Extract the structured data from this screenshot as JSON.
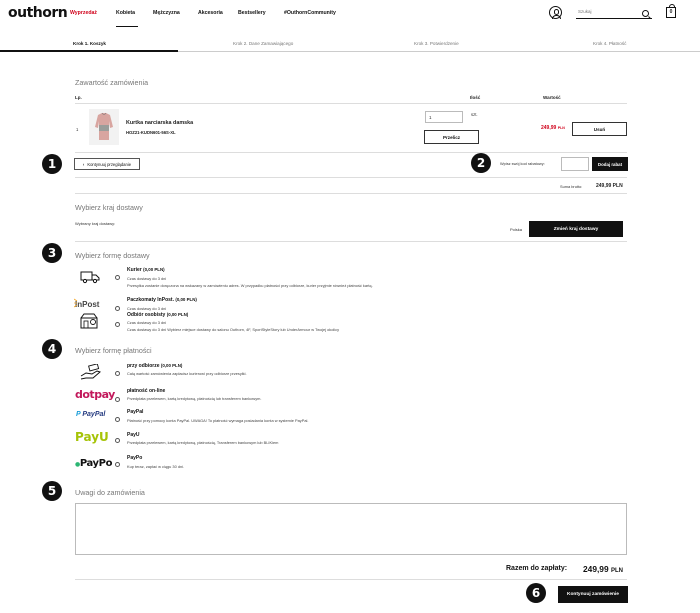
{
  "header": {
    "logo": "outhorn",
    "nav": [
      "Wyprzedaż",
      "Kobieta",
      "Mężczyzna",
      "Akcesoria",
      "Bestsellery",
      "#OuthornCommunity"
    ],
    "search_placeholder": "Szukaj",
    "cart_count": "0"
  },
  "steps": [
    "Krok 1. Koszyk",
    "Krok 2. Dane Zamawiającego",
    "Krok 3. Potwierdzenie",
    "Krok 4. Płatność"
  ],
  "cart": {
    "title": "Zawartość zamówienia",
    "col_lp": "Lp.",
    "col_qty": "Ilość",
    "col_value": "Wartość",
    "item": {
      "lp": "1",
      "name": "Kurtka narciarska damska",
      "sku": "HOZ21-KUDN601-56S-XL",
      "qty": "1",
      "unit": "szt.",
      "recalc": "Przelicz",
      "price": "249,99",
      "price_currency": "PLN",
      "remove": "Usuń"
    },
    "continue": "Kontynuuj przeglądanie",
    "coupon_label": "Wpisz swój kod rabatowy:",
    "coupon_value": "",
    "coupon_button": "Dodaj rabat",
    "gross_label": "Suma brutto:",
    "gross_value": "249,99 PLN"
  },
  "country": {
    "title": "Wybierz kraj dostawy",
    "selected_label": "Wybrany kraj dostawy:",
    "selected_value": "Polska",
    "change_button": "Zmień kraj dostawy"
  },
  "delivery": {
    "title": "Wybierz formę dostawy",
    "options": [
      {
        "name": "Kurier",
        "price": "(0,00 PLN)",
        "desc1": "Czas dostawy do 3 dni",
        "desc2": "Przesyłka zostanie doręczona na wskazany w zamówieniu adres. W przypadku płatności przy odbiorze, kurier przyjmie również płatność kartą."
      },
      {
        "name": "Paczkomaty InPost.",
        "price": "(0,00 PLN)",
        "desc1": "Czas dostawy do 3 dni",
        "desc2": ""
      },
      {
        "name": "Odbiór osobisty",
        "price": "(0,00 PLN)",
        "desc1": "Czas dostawy do 3 dni",
        "desc2": "Czas dostawy do 3 dni Wybierz miejsce dostawy do salonu Outhorn, 4F, SportStyleStory lub UnderArmour w Twojej okolicy"
      }
    ],
    "icons": [
      "truck-icon",
      "inpost-logo",
      "store-pickup-icon"
    ]
  },
  "payment": {
    "title": "Wybierz formę płatności",
    "options": [
      {
        "name": "przy odbiorze",
        "price": "(0,00 PLN)",
        "desc": "Całą wartość zamówienia zapłacisz kurierowi przy odbiorze przesyłki.",
        "logo": "hand-cash-icon"
      },
      {
        "name": "płatność on-line",
        "price": "",
        "desc": "Przedpłata przelewem, kartą kredytową, płatnością lub transferem bankowym.",
        "logo": "dotpay"
      },
      {
        "name": "PayPal",
        "price": "",
        "desc": "Płatność przy pomocy konta PayPal. UWAGA! To płatność wymaga posiadania konta w systemie PayPal.",
        "logo": "PayPal"
      },
      {
        "name": "PayU",
        "price": "",
        "desc": "Przedpłata przelewem, kartą kredytową, płatnością, Transferem bankowym lub BLIKiem",
        "logo": "PayU"
      },
      {
        "name": "PayPo",
        "price": "",
        "desc": "Kup teraz, zapłać w ciągu 30 dni.",
        "logo": "PayPo"
      }
    ]
  },
  "notes": {
    "title": "Uwagi do zamówienia",
    "value": ""
  },
  "summary": {
    "label": "Razem do zapłaty:",
    "value": "249,99",
    "currency": "PLN",
    "continue_button": "Kontynuuj zamówienie"
  },
  "annotations": [
    "1",
    "2",
    "3",
    "4",
    "5",
    "6"
  ],
  "colors": {
    "accent_red": "#d0021b",
    "dark": "#111111"
  }
}
